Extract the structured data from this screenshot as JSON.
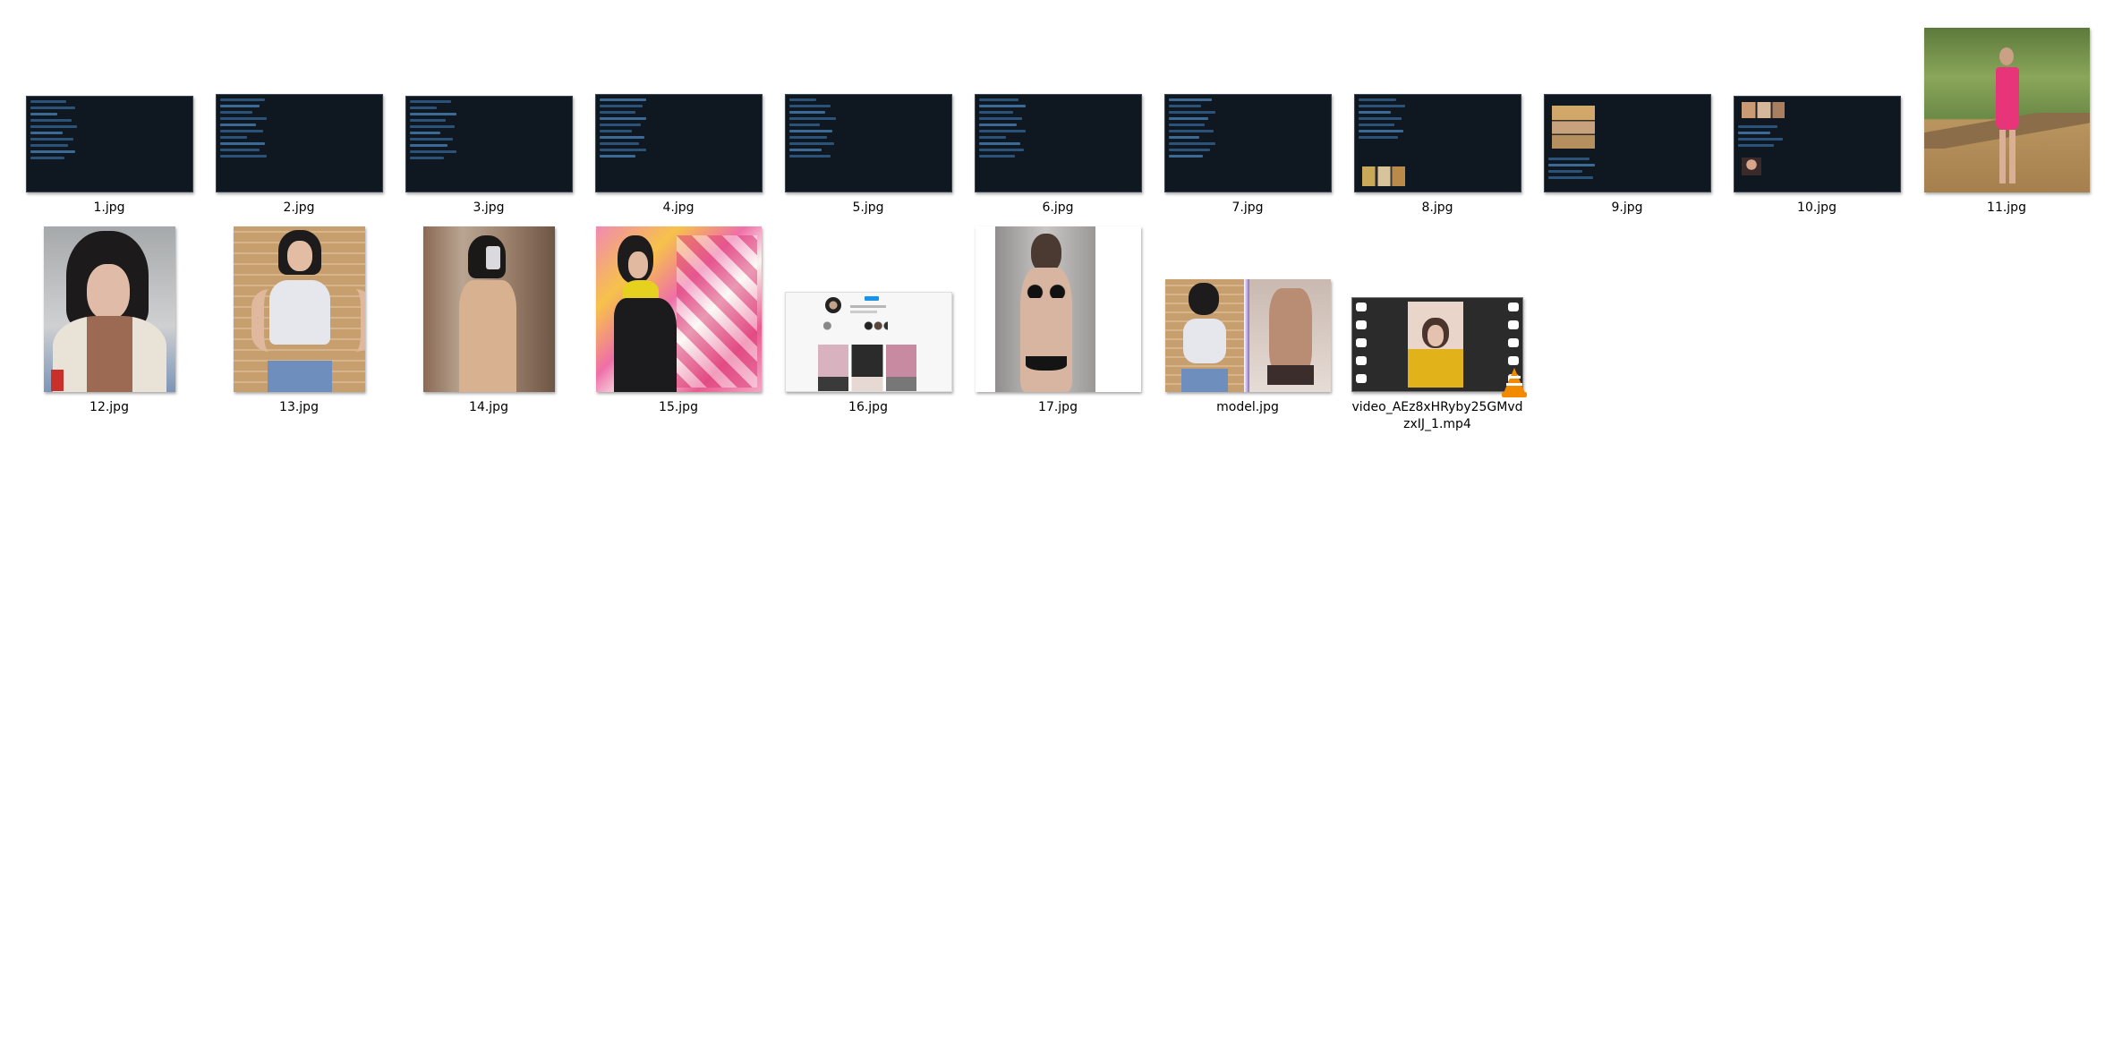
{
  "files": [
    {
      "name": "1.jpg",
      "kind": "screenshot"
    },
    {
      "name": "2.jpg",
      "kind": "screenshot"
    },
    {
      "name": "3.jpg",
      "kind": "screenshot"
    },
    {
      "name": "4.jpg",
      "kind": "screenshot"
    },
    {
      "name": "5.jpg",
      "kind": "screenshot"
    },
    {
      "name": "6.jpg",
      "kind": "screenshot"
    },
    {
      "name": "7.jpg",
      "kind": "screenshot"
    },
    {
      "name": "8.jpg",
      "kind": "screenshot"
    },
    {
      "name": "9.jpg",
      "kind": "screenshot"
    },
    {
      "name": "10.jpg",
      "kind": "screenshot"
    },
    {
      "name": "11.jpg",
      "kind": "photo"
    },
    {
      "name": "12.jpg",
      "kind": "photo"
    },
    {
      "name": "13.jpg",
      "kind": "photo"
    },
    {
      "name": "14.jpg",
      "kind": "photo"
    },
    {
      "name": "15.jpg",
      "kind": "photo"
    },
    {
      "name": "16.jpg",
      "kind": "screenshot"
    },
    {
      "name": "17.jpg",
      "kind": "photo"
    },
    {
      "name": "model.jpg",
      "kind": "photo"
    },
    {
      "name": "video_AEz8xHRyby25GMvdzxIJ_1.mp4",
      "kind": "video",
      "icon": "vlc-cone-icon"
    }
  ],
  "colors": {
    "background": "#ffffff",
    "screenshot_bg": "#0f1721",
    "message_bubble": "#2b5278",
    "accent_pink": "#e8357a",
    "vlc_orange": "#f28a00"
  }
}
